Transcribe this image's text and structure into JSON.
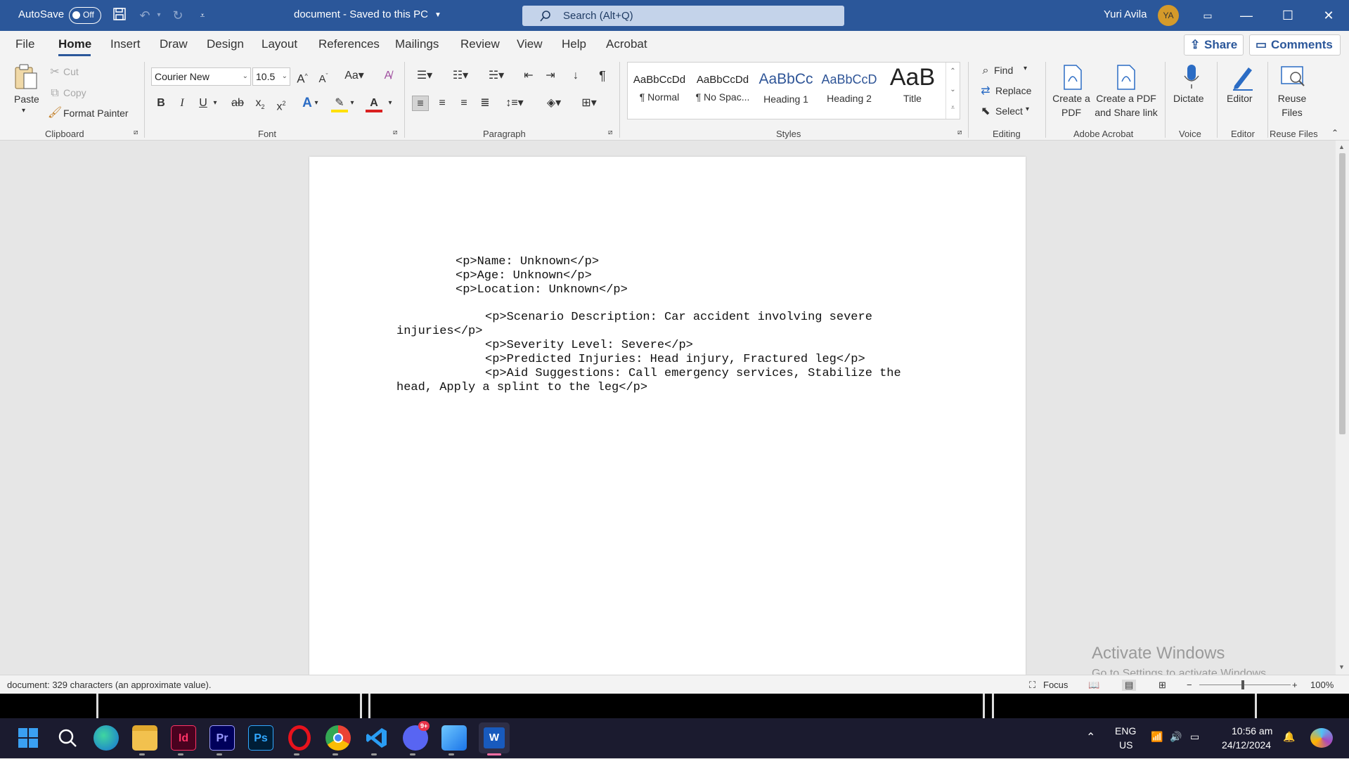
{
  "titlebar": {
    "autosave_label": "AutoSave",
    "autosave_state": "Off",
    "doc_title": "document - Saved to this PC",
    "search_placeholder": "Search (Alt+Q)",
    "user_name": "Yuri Avila",
    "user_initials": "YA",
    "accent_color": "#2b579a"
  },
  "tabs": [
    "File",
    "Home",
    "Insert",
    "Draw",
    "Design",
    "Layout",
    "References",
    "Mailings",
    "Review",
    "View",
    "Help",
    "Acrobat"
  ],
  "active_tab": "Home",
  "share_label": "Share",
  "comments_label": "Comments",
  "clipboard": {
    "paste": "Paste",
    "cut": "Cut",
    "copy": "Copy",
    "format_painter": "Format Painter",
    "group": "Clipboard"
  },
  "font": {
    "name": "Courier New",
    "size": "10.5",
    "group": "Font"
  },
  "paragraph": {
    "group": "Paragraph"
  },
  "styles": {
    "items": [
      {
        "preview": "AaBbCcDd",
        "name": "¶ Normal"
      },
      {
        "preview": "AaBbCcDd",
        "name": "¶ No Spac..."
      },
      {
        "preview": "AaBbCc",
        "name": "Heading 1"
      },
      {
        "preview": "AaBbCcD",
        "name": "Heading 2"
      },
      {
        "preview": "AaB",
        "name": "Title"
      }
    ],
    "group": "Styles"
  },
  "editing": {
    "find": "Find",
    "replace": "Replace",
    "select": "Select",
    "group": "Editing"
  },
  "acrobat": {
    "create_pdf": "Create a PDF",
    "create_share": "Create a PDF and Share link",
    "group": "Adobe Acrobat"
  },
  "voice": {
    "dictate": "Dictate",
    "group": "Voice"
  },
  "editor": {
    "label": "Editor",
    "group": "Editor"
  },
  "reuse": {
    "label": "Reuse Files",
    "group": "Reuse Files"
  },
  "document": {
    "lines": [
      "<p>Name: Unknown</p>",
      "<p>Age: Unknown</p>",
      "<p>Location: Unknown</p>",
      "<p>Scenario Description: Car accident involving severe",
      "injuries</p>",
      "<p>Severity Level: Severe</p>",
      "<p>Predicted Injuries: Head injury, Fractured leg</p>",
      "<p>Aid Suggestions: Call emergency services, Stabilize the",
      "head, Apply a splint to the leg</p>"
    ]
  },
  "watermark": {
    "title": "Activate Windows",
    "subtitle": "Go to Settings to activate Windows."
  },
  "statusbar": {
    "word_count": "document: 329 characters (an approximate value).",
    "focus": "Focus",
    "zoom": "100%"
  },
  "taskbar": {
    "apps": [
      "start-icon",
      "search-icon",
      "edge-icon",
      "file-explorer-icon",
      "indesign-icon",
      "premiere-icon",
      "photoshop-icon",
      "opera-icon",
      "chrome-icon",
      "vscode-icon",
      "discord-icon",
      "photos-icon",
      "word-icon"
    ],
    "app_labels": {
      "indesign": "Id",
      "premiere": "Pr",
      "photoshop": "Ps",
      "word": "W",
      "discord_badge": "9+"
    },
    "language": "ENG",
    "region": "US",
    "time": "10:56 am",
    "date": "24/12/2024"
  }
}
